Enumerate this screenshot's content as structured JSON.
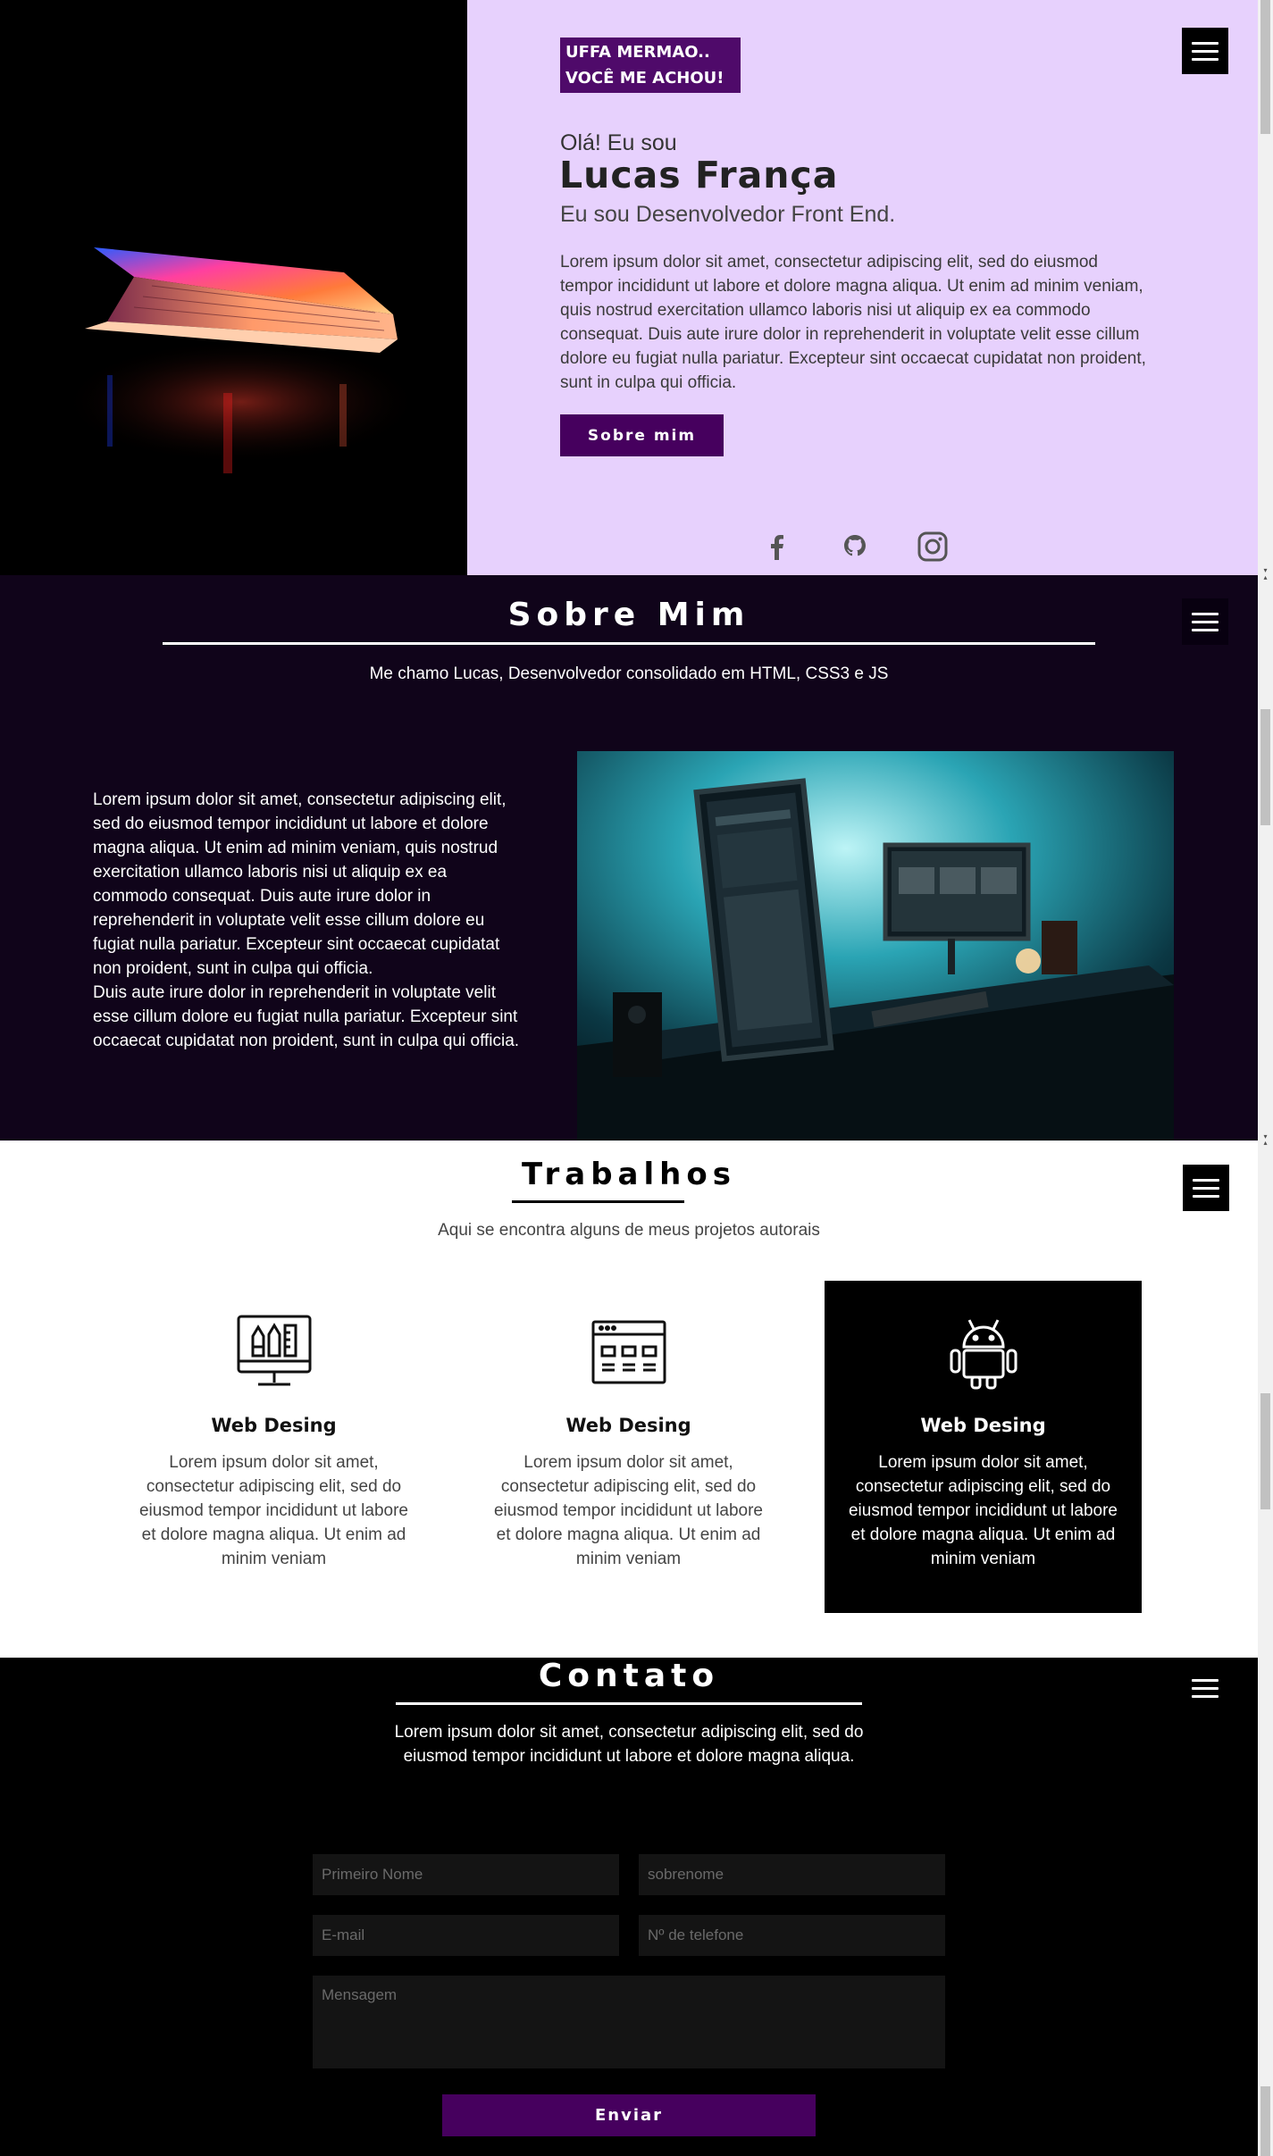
{
  "hero": {
    "badge_line1": "UFFA MERMAO..",
    "badge_line2": "VOCÊ ME ACHOU!",
    "greeting": "Olá! Eu sou",
    "name": "Lucas França",
    "role": "Eu sou Desenvolvedor Front End.",
    "text": "Lorem ipsum dolor sit amet, consectetur adipiscing elit, sed do eiusmod tempor incididunt ut labore et dolore magna aliqua. Ut enim ad minim veniam, quis nostrud exercitation ullamco laboris nisi ut aliquip ex ea commodo consequat. Duis aute irure dolor in reprehenderit in voluptate velit esse cillum dolore eu fugiat nulla pariatur. Excepteur sint occaecat cupidatat non proident, sunt in culpa qui officia.",
    "button": "Sobre mim",
    "social_icons": [
      "facebook-icon",
      "github-icon",
      "instagram-icon"
    ]
  },
  "sobre": {
    "title": "Sobre Mim",
    "subtitle": "Me chamo Lucas, Desenvolvedor consolidado em HTML, CSS3 e JS",
    "paragraph1": "Lorem ipsum dolor sit amet, consectetur adipiscing elit, sed do eiusmod tempor incididunt ut labore et dolore magna aliqua. Ut enim ad minim veniam, quis nostrud exercitation ullamco laboris nisi ut aliquip ex ea commodo consequat. Duis aute irure dolor in reprehenderit in voluptate velit esse cillum dolore eu fugiat nulla pariatur. Excepteur sint occaecat cupidatat non proident, sunt in culpa qui officia.",
    "paragraph2": "Duis aute irure dolor in reprehenderit in voluptate velit esse cillum dolore eu fugiat nulla pariatur. Excepteur sint occaecat cupidatat non proident, sunt in culpa qui officia."
  },
  "trabalhos": {
    "title": "Trabalhos",
    "subtitle": "Aqui se encontra alguns de meus projetos autorais",
    "cards": [
      {
        "icon": "monitor-design-tools-icon",
        "title": "Web Desing",
        "text": "Lorem ipsum dolor sit amet, consectetur adipiscing elit, sed do eiusmod tempor incididunt ut labore et dolore magna aliqua. Ut enim ad minim veniam"
      },
      {
        "icon": "browser-window-icon",
        "title": "Web Desing",
        "text": "Lorem ipsum dolor sit amet, consectetur adipiscing elit, sed do eiusmod tempor incididunt ut labore et dolore magna aliqua. Ut enim ad minim veniam"
      },
      {
        "icon": "android-icon",
        "title": "Web Desing",
        "text": "Lorem ipsum dolor sit amet, consectetur adipiscing elit, sed do eiusmod tempor incididunt ut labore et dolore magna aliqua. Ut enim ad minim veniam"
      }
    ]
  },
  "contato": {
    "title": "Contato",
    "subtitle": "Lorem ipsum dolor sit amet, consectetur adipiscing elit, sed do eiusmod tempor incididunt ut labore et dolore magna aliqua.",
    "first_name_placeholder": "Primeiro Nome",
    "last_name_placeholder": "sobrenome",
    "email_placeholder": "E-mail",
    "phone_placeholder": "Nº de telefone",
    "message_placeholder": "Mensagem",
    "submit": "Enviar"
  },
  "colors": {
    "hero_bg": "#e7d1fd",
    "accent_purple": "#46005e",
    "sobre_bg": "#10041a",
    "contato_bg": "#000000"
  }
}
